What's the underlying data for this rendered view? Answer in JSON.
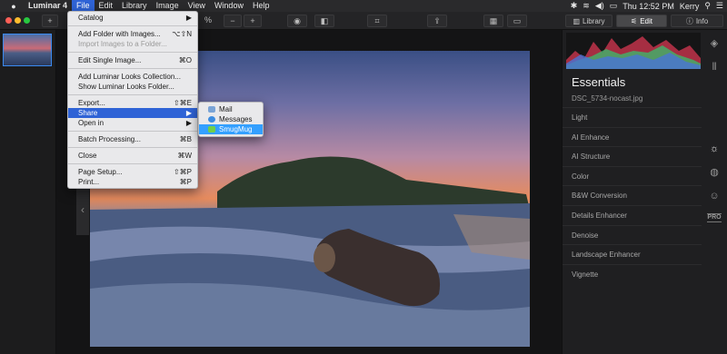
{
  "menubar": {
    "apple_icon": "apple-icon",
    "app_name": "Luminar 4",
    "items": [
      "File",
      "Edit",
      "Library",
      "Image",
      "View",
      "Window",
      "Help"
    ],
    "clock": "Thu 12:52 PM",
    "user": "Kerry"
  },
  "toolbar": {
    "zoom_fragment": "%",
    "zoom_minus": "−",
    "zoom_plus": "+",
    "add": "+",
    "tabs": {
      "library": "Library",
      "edit": "Edit",
      "info": "Info"
    }
  },
  "file_menu": {
    "items": [
      {
        "label": "Catalog",
        "shortcut": "▶"
      },
      {
        "label": "Add Folder with Images...",
        "shortcut": "⌥⇧N"
      },
      {
        "label": "Import Images to a Folder...",
        "shortcut": ""
      },
      {
        "label": "Edit Single Image...",
        "shortcut": "⌘O"
      },
      {
        "label": "Add Luminar Looks Collection...",
        "shortcut": ""
      },
      {
        "label": "Show Luminar Looks Folder...",
        "shortcut": ""
      },
      {
        "label": "Export...",
        "shortcut": "⇧⌘E"
      },
      {
        "label": "Share",
        "shortcut": "▶"
      },
      {
        "label": "Open in",
        "shortcut": "▶"
      },
      {
        "label": "Batch Processing...",
        "shortcut": "⌘B"
      },
      {
        "label": "Close",
        "shortcut": "⌘W"
      },
      {
        "label": "Page Setup...",
        "shortcut": "⇧⌘P"
      },
      {
        "label": "Print...",
        "shortcut": "⌘P"
      }
    ]
  },
  "share_menu": {
    "items": [
      {
        "label": "Mail",
        "icon": "mail-icon",
        "color": "#7aa4d6"
      },
      {
        "label": "Messages",
        "icon": "messages-icon",
        "color": "#3c8ce0"
      },
      {
        "label": "SmugMug",
        "icon": "smugmug-icon",
        "color": "#6fcf4a"
      }
    ]
  },
  "right_panel": {
    "title": "Essentials",
    "filename": "DSC_5734-nocast.jpg",
    "tools": [
      "Light",
      "AI Enhance",
      "AI Structure",
      "Color",
      "B&W Conversion",
      "Details Enhancer",
      "Denoise",
      "Landscape Enhancer",
      "Vignette"
    ],
    "pro_badge": "PRO"
  },
  "colors": {
    "menu_highlight": "#2f63d6",
    "submenu_highlight": "#34a0ff",
    "thumb_border": "#3a8af0"
  }
}
